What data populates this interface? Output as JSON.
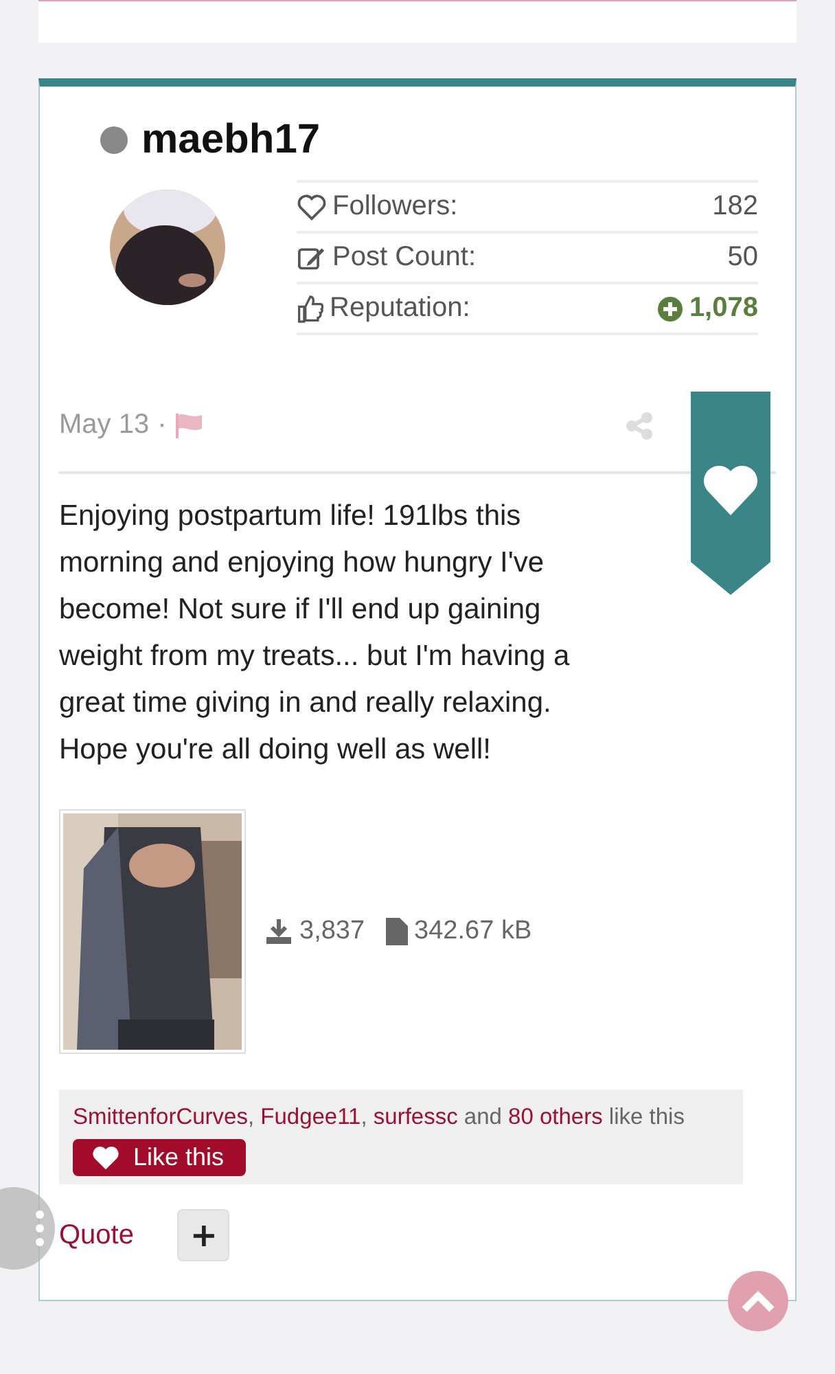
{
  "user": {
    "name": "maebh17",
    "online": false
  },
  "stats": [
    {
      "kind": "followers",
      "label": "Followers:",
      "value": "182"
    },
    {
      "kind": "posts",
      "label": "Post Count:",
      "value": "50"
    },
    {
      "kind": "reputation",
      "label": "Reputation:",
      "value": "1,078"
    }
  ],
  "post": {
    "date": "May 13",
    "separator": "·",
    "liked": true,
    "text": "Enjoying postpartum life! 191lbs this morning and enjoying how hungry I've become! Not sure if I'll end up gaining weight from my treats... but I'm having a great time giving in and really relaxing. Hope you're all doing well as well!"
  },
  "attachment": {
    "kind": "picture",
    "downloads": "3,837",
    "size": "342.67 kB"
  },
  "likes": {
    "parts": [
      {
        "kind": "link",
        "text": "SmittenforCurves",
        "separator": ", "
      },
      {
        "kind": "link",
        "text": "Fudgee11",
        "separator": ", "
      },
      {
        "kind": "link",
        "text": "surfessc"
      },
      {
        "kind": "plain",
        "text": " and "
      },
      {
        "kind": "link",
        "text": "80 others"
      },
      {
        "kind": "plain",
        "text": " like this"
      }
    ],
    "button": "Like this"
  },
  "actions": {
    "quote": "Quote",
    "more": "+"
  }
}
